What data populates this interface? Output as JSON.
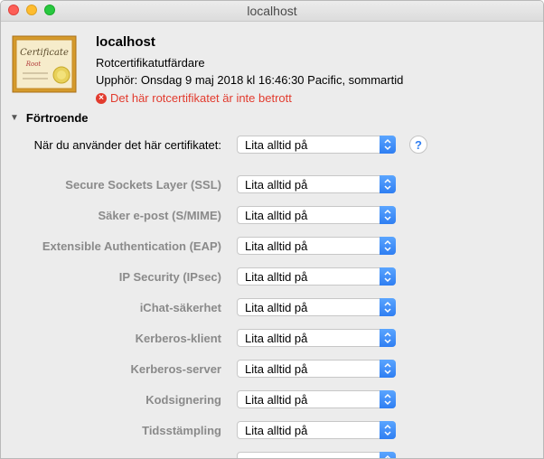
{
  "window": {
    "title": "localhost"
  },
  "certificate": {
    "name": "localhost",
    "issuer_type": "Rotcertifikatutfärdare",
    "expires": "Upphör: Onsdag 9 maj 2018 kl 16:46:30 Pacific, sommartid",
    "warning": "Det här rotcertifikatet är inte betrott",
    "icon_text": "Certificate",
    "icon_subtext": "Root"
  },
  "trust": {
    "section_label": "Förtroende",
    "main": {
      "label": "När du använder det här certifikatet:",
      "value": "Lita alltid på"
    },
    "help_glyph": "?",
    "rows": [
      {
        "label": "Secure Sockets Layer (SSL)",
        "value": "Lita alltid på"
      },
      {
        "label": "Säker e-post (S/MIME)",
        "value": "Lita alltid på"
      },
      {
        "label": "Extensible Authentication (EAP)",
        "value": "Lita alltid på"
      },
      {
        "label": "IP Security (IPsec)",
        "value": "Lita alltid på"
      },
      {
        "label": "iChat-säkerhet",
        "value": "Lita alltid på"
      },
      {
        "label": "Kerberos-klient",
        "value": "Lita alltid på"
      },
      {
        "label": "Kerberos-server",
        "value": "Lita alltid på"
      },
      {
        "label": "Kodsignering",
        "value": "Lita alltid på"
      },
      {
        "label": "Tidsstämpling",
        "value": "Lita alltid på"
      },
      {
        "label": "",
        "value": ""
      }
    ]
  },
  "colors": {
    "accent": "#2f7ef2",
    "warning": "#e23b2e",
    "dim_label": "#8a8a8a"
  }
}
